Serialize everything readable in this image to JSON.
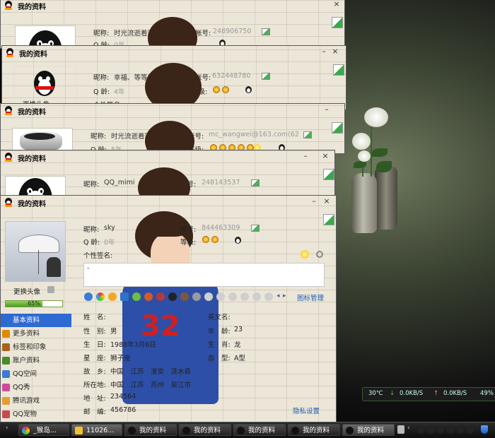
{
  "window_title": "我的资料",
  "window_buttons": {
    "minimize": "–",
    "close": "×"
  },
  "labels": {
    "nickname": "昵称:",
    "account": "帐号:",
    "qq_age": "Q 龄:",
    "level": "等级:",
    "signature": "个性签名:",
    "change_avatar": "更换头像"
  },
  "windows": [
    {
      "nickname": "时光流逝着寂寞韵",
      "account": "248906750",
      "qq_age": "0年"
    },
    {
      "nickname": "幸福、等等我",
      "account": "632448780",
      "qq_age": "4年",
      "signature_partial": "个性签名",
      "change_avatar_partial": "更换头像"
    },
    {
      "nickname": "时光流逝着寂寞韵",
      "account": "mc_wangwei@163.com(62268",
      "qq_age": "5年"
    },
    {
      "nickname": "QQ_mimi",
      "account": "248143537"
    },
    {
      "nickname": "sky",
      "account": "844463309",
      "qq_age": "0年",
      "signature_text": "-"
    }
  ],
  "main": {
    "progress_percent": 65,
    "progress_label": "65%",
    "manage_link": "图标管理",
    "privacy_link": "隐私设置",
    "sidebar": [
      {
        "label": "基本资料",
        "icon": "profile-icon",
        "active": true
      },
      {
        "label": "更多资料",
        "icon": "more-info-icon",
        "active": false
      },
      {
        "label": "标签和印象",
        "icon": "tag-icon",
        "active": false
      },
      {
        "label": "账户资料",
        "icon": "account-icon",
        "active": false
      },
      {
        "label": "QQ空间",
        "icon": "qzone-icon",
        "active": false
      },
      {
        "label": "QQ秀",
        "icon": "qqshow-icon",
        "active": false
      },
      {
        "label": "腾讯游戏",
        "icon": "game-icon",
        "active": false
      },
      {
        "label": "QQ宠物",
        "icon": "pet-icon",
        "active": false
      }
    ],
    "fields": {
      "name_label": "姓　名:",
      "name": "",
      "gender_label": "性　别:",
      "gender": "男",
      "birthday_label": "生　日:",
      "birthday": "1988年3月6日",
      "zodiac_label": "星　座:",
      "zodiac": "狮子座",
      "hometown_label": "故　乡:",
      "hometown": "中国　江苏　淮安　涟水县",
      "location_label": "所在地:",
      "location": "中国　江苏　苏州　吴江市",
      "address_label": "地　址:",
      "address": "234564",
      "postcode_label": "邮　编:",
      "postcode": "456786",
      "english_name_label": "英文名:",
      "english_name": "",
      "age_label": "年　龄:",
      "age": "23",
      "chinese_zodiac_label": "生　肖:",
      "chinese_zodiac": "龙",
      "blood_label": "血　型:",
      "blood": "A型"
    },
    "photo_number": "32"
  },
  "status_widget": {
    "temperature": "30℃",
    "download": "0.0KB/S",
    "upload": "0.0KB/S",
    "cpu": "49%"
  },
  "taskbar": {
    "items": [
      {
        "label": "_猴岛..."
      },
      {
        "label": "11026..."
      },
      {
        "label": "我的资料"
      },
      {
        "label": "我的资料"
      },
      {
        "label": "我的资料"
      },
      {
        "label": "我的资料"
      },
      {
        "label": "我的资料"
      }
    ]
  },
  "colors": {
    "accent": "#2d6ad2",
    "link": "#1a5fb4",
    "progress": "#4a9d22",
    "taskbar": "#1a1a1a"
  }
}
